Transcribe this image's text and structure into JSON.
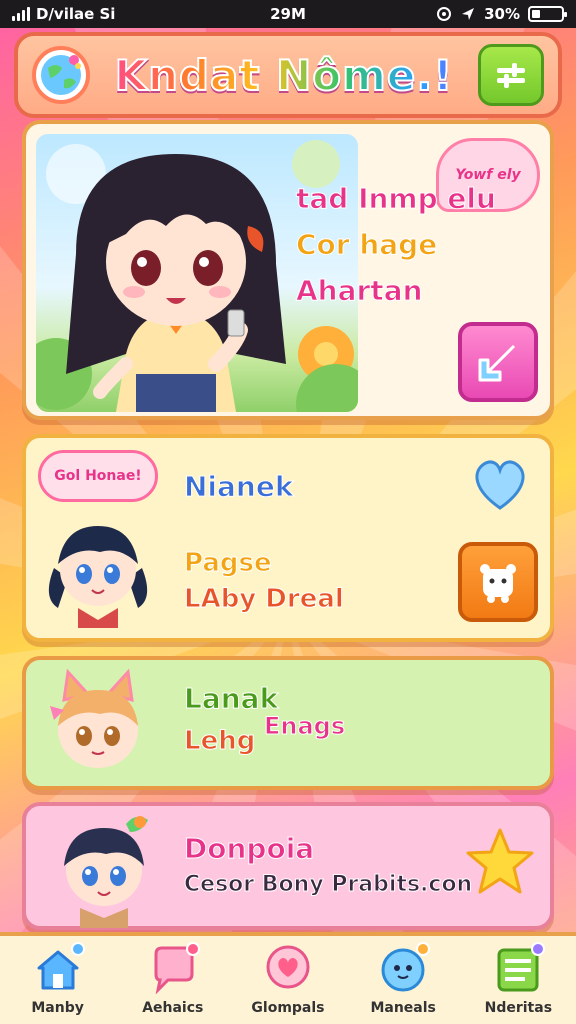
{
  "status_bar": {
    "carrier": "D/vilae Si",
    "time": "29M",
    "battery": "30%",
    "battery_level": 0.3
  },
  "header": {
    "title": "Kndat Nôme.!",
    "logo_icon": "globe-icon",
    "menu_icon": "sliders-icon"
  },
  "hero": {
    "bubble_text": "Yowf ely",
    "lines": [
      "tad Inmp elu",
      "Cor hage",
      "Ahartan"
    ],
    "button_icon": "arrow-icon"
  },
  "cards": [
    {
      "badge": "Gol Honae!",
      "title": "Nianek",
      "line1": "Pagse",
      "line2": "LAby Dreal",
      "icon_top": "heart-icon",
      "button_icon": "pet-icon"
    },
    {
      "title": "Lanak",
      "line1": "Lehg",
      "line2": "Enags"
    },
    {
      "title": "Donpoia",
      "line1": "Cesor Bony Prabits.con",
      "icon": "star-icon"
    }
  ],
  "bottom_nav": [
    {
      "label": "Manby",
      "icon": "home-icon"
    },
    {
      "label": "Aehaics",
      "icon": "chat-icon"
    },
    {
      "label": "Glompals",
      "icon": "heart-bubble-icon"
    },
    {
      "label": "Maneals",
      "icon": "cute-face-icon"
    },
    {
      "label": "Nderitas",
      "icon": "list-icon"
    }
  ],
  "colors": {
    "accent_pink": "#e8338a",
    "accent_orange": "#f2a414",
    "accent_green": "#74c82c",
    "accent_blue": "#3a6ed8"
  }
}
